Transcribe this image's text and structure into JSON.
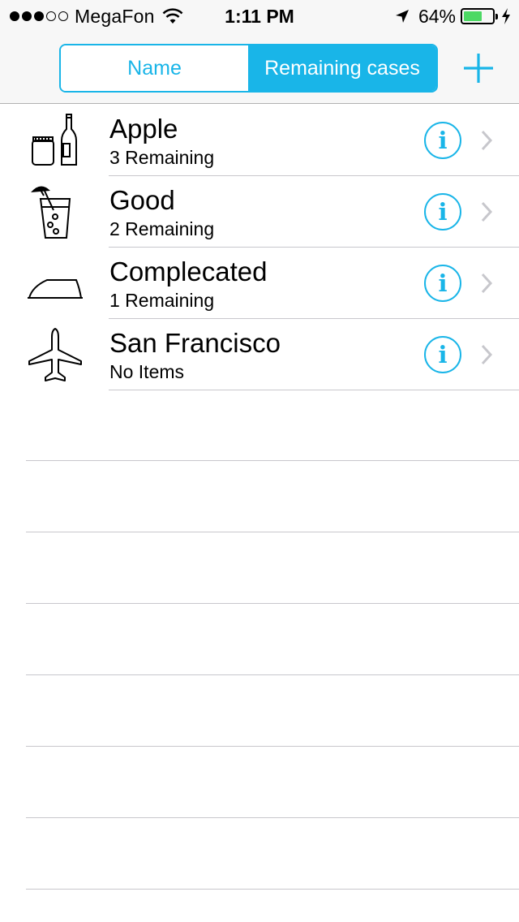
{
  "status_bar": {
    "signal_filled": 3,
    "signal_total": 5,
    "carrier": "MegaFon",
    "time": "1:11 PM",
    "battery_percent": "64%",
    "battery_level": 0.64,
    "battery_color": "#4cd964"
  },
  "nav": {
    "segments": [
      {
        "label": "Name",
        "selected": false
      },
      {
        "label": "Remaining cases",
        "selected": true
      }
    ],
    "add_icon": "plus-icon",
    "accent_color": "#19b5e8"
  },
  "items": [
    {
      "title": "Apple",
      "subtitle": "3 Remaining",
      "icon": "jar-bottle-icon"
    },
    {
      "title": "Good",
      "subtitle": "2 Remaining",
      "icon": "cocktail-icon"
    },
    {
      "title": "Complecated",
      "subtitle": "1 Remaining",
      "icon": "iron-icon"
    },
    {
      "title": "San Francisco",
      "subtitle": "No Items",
      "icon": "airplane-icon"
    }
  ],
  "info_glyph": "i"
}
